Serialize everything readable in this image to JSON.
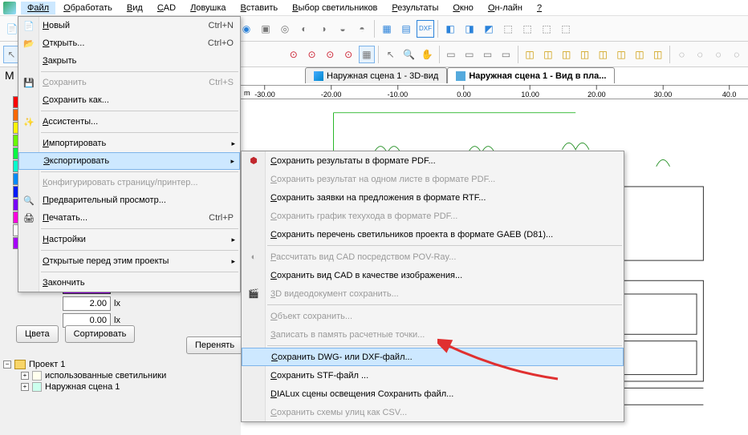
{
  "menubar": {
    "items": [
      "Файл",
      "Обработать",
      "Вид",
      "CAD",
      "Ловушка",
      "Вставить",
      "Выбор светильников",
      "Результаты",
      "Окно",
      "Он-лайн",
      "?"
    ]
  },
  "file_menu": {
    "new": {
      "label": "Новый",
      "shortcut": "Ctrl+N"
    },
    "open": {
      "label": "Открыть...",
      "shortcut": "Ctrl+O"
    },
    "close": {
      "label": "Закрыть"
    },
    "save": {
      "label": "Сохранить",
      "shortcut": "Ctrl+S"
    },
    "saveas": {
      "label": "Сохранить как..."
    },
    "assist": {
      "label": "Ассистенты..."
    },
    "import": {
      "label": "Импортировать"
    },
    "export": {
      "label": "Экспортировать"
    },
    "pageconf": {
      "label": "Конфигурировать страницу/принтер..."
    },
    "preview": {
      "label": "Предварительный просмотр..."
    },
    "print": {
      "label": "Печатать...",
      "shortcut": "Ctrl+P"
    },
    "settings": {
      "label": "Настройки"
    },
    "recent": {
      "label": "Открытые перед этим проекты"
    },
    "exit": {
      "label": "Закончить"
    }
  },
  "export_menu": {
    "pdf": {
      "label": "Сохранить результаты в формате PDF..."
    },
    "pdf_one": {
      "label": "Сохранить результат на одном листе в формате PDF..."
    },
    "rtf": {
      "label": "Сохранить заявки на предложения в формате RTF..."
    },
    "maint_pdf": {
      "label": "Сохранить график техухода в формате PDF..."
    },
    "gaeb": {
      "label": "Сохранить перечень светильников проекта в формате GAEB (D81)..."
    },
    "povray": {
      "label": "Рассчитать вид CAD посредством POV-Ray..."
    },
    "cad_img": {
      "label": "Сохранить вид CAD в качестве изображения..."
    },
    "vid3d": {
      "label": "3D видеодокумент сохранить..."
    },
    "obj": {
      "label": "Объект сохранить..."
    },
    "calc_pts": {
      "label": "Записать в память расчетные точки..."
    },
    "dwg": {
      "label": "Сохранить DWG- или DXF-файл..."
    },
    "stf": {
      "label": "Сохранить STF-файл ..."
    },
    "lightscene": {
      "label": "DIALux сцены освещения Cохранить файл..."
    },
    "csv": {
      "label": "Сохранить схемы улиц как CSV..."
    }
  },
  "left": {
    "M": "M",
    "val1": "2.00",
    "val2": "0.00",
    "lx": "lx",
    "btn_colors": "Цвета",
    "btn_sort": "Сортировать",
    "btn_accept": "Перенять"
  },
  "tree": {
    "root": "Проект 1",
    "child1": "использованные светильники",
    "child2": "Наружная сцена 1"
  },
  "tabs": {
    "tab1": "Наружная сцена 1 - 3D-вид",
    "tab2": "Наружная сцена 1 - Вид в пла..."
  },
  "ruler": {
    "unit": "m",
    "ticks": [
      "-30.00",
      "-20.00",
      "-10.00",
      "0.00",
      "10.00",
      "20.00",
      "30.00",
      "40.0"
    ]
  },
  "colors": [
    "#ff0000",
    "#ff6a00",
    "#fff700",
    "#6aff00",
    "#00ff44",
    "#00ffd0",
    "#008cff",
    "#001aff",
    "#7a00ff",
    "#ff00e1",
    "#fff",
    "#a800ff"
  ]
}
